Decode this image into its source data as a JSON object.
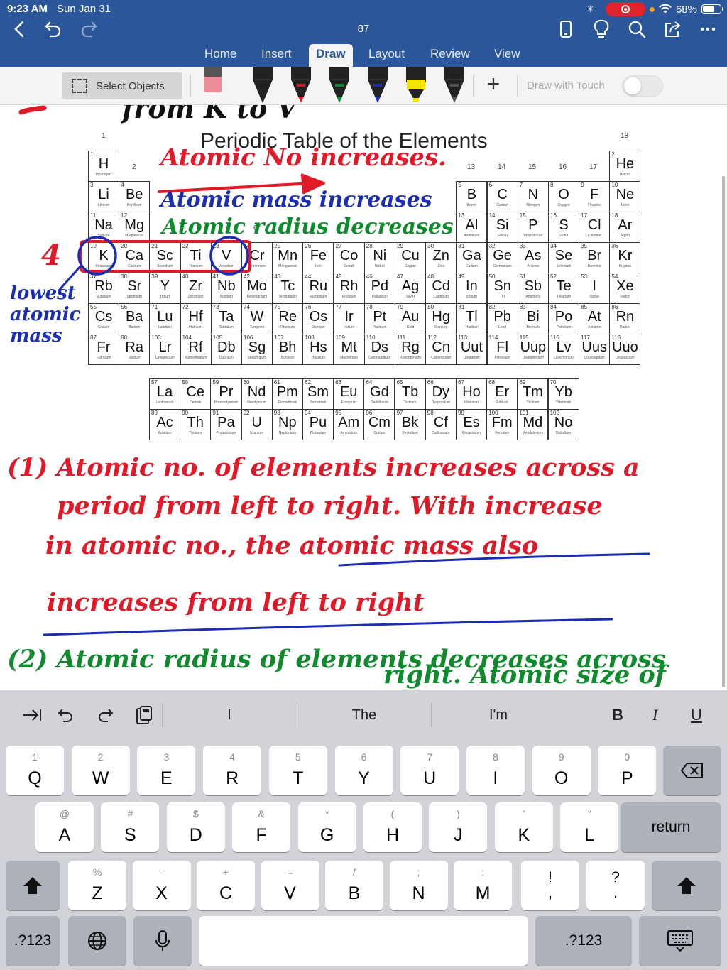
{
  "status_bar": {
    "time": "9:23 AM",
    "date": "Sun Jan 31",
    "battery": "68%"
  },
  "document": {
    "title": "87"
  },
  "tabs": [
    {
      "label": "Home",
      "active": false
    },
    {
      "label": "Insert",
      "active": false
    },
    {
      "label": "Draw",
      "active": true
    },
    {
      "label": "Layout",
      "active": false
    },
    {
      "label": "Review",
      "active": false
    },
    {
      "label": "View",
      "active": false
    }
  ],
  "ribbon": {
    "select_objects": "Select Objects",
    "draw_with_touch": "Draw with Touch",
    "draw_with_touch_on": false,
    "pen_colors": [
      "#ef8b96",
      "#1e1e1e",
      "#d41e2c",
      "#128a35",
      "#1c2db5",
      "#f5e400",
      "#555555"
    ]
  },
  "periodic_table": {
    "title": "Periodic Table of the Elements",
    "group_labels": [
      "1",
      "2",
      "13",
      "14",
      "15",
      "16",
      "17",
      "18",
      "6"
    ],
    "elements": [
      [
        "1",
        "H",
        "Hydrogen",
        1,
        1
      ],
      [
        "2",
        "He",
        "Helium",
        1,
        18
      ],
      [
        "3",
        "Li",
        "Lithium",
        2,
        1
      ],
      [
        "4",
        "Be",
        "Beryllium",
        2,
        2
      ],
      [
        "5",
        "B",
        "Boron",
        2,
        13
      ],
      [
        "6",
        "C",
        "Carbon",
        2,
        14
      ],
      [
        "7",
        "N",
        "Nitrogen",
        2,
        15
      ],
      [
        "8",
        "O",
        "Oxygen",
        2,
        16
      ],
      [
        "9",
        "F",
        "Fluorine",
        2,
        17
      ],
      [
        "10",
        "Ne",
        "Neon",
        2,
        18
      ],
      [
        "11",
        "Na",
        "Sodium",
        3,
        1
      ],
      [
        "12",
        "Mg",
        "Magnesium",
        3,
        2
      ],
      [
        "13",
        "Al",
        "Aluminum",
        3,
        13
      ],
      [
        "14",
        "Si",
        "Silicon",
        3,
        14
      ],
      [
        "15",
        "P",
        "Phosphorus",
        3,
        15
      ],
      [
        "16",
        "S",
        "Sulfur",
        3,
        16
      ],
      [
        "17",
        "Cl",
        "Chlorine",
        3,
        17
      ],
      [
        "18",
        "Ar",
        "Argon",
        3,
        18
      ],
      [
        "19",
        "K",
        "Potassium",
        4,
        1
      ],
      [
        "20",
        "Ca",
        "Calcium",
        4,
        2
      ],
      [
        "21",
        "Sc",
        "Scandium",
        4,
        3
      ],
      [
        "22",
        "Ti",
        "Titanium",
        4,
        4
      ],
      [
        "23",
        "V",
        "Vanadium",
        4,
        5
      ],
      [
        "24",
        "Cr",
        "Chromium",
        4,
        6
      ],
      [
        "25",
        "Mn",
        "Manganese",
        4,
        7
      ],
      [
        "26",
        "Fe",
        "Iron",
        4,
        8
      ],
      [
        "27",
        "Co",
        "Cobalt",
        4,
        9
      ],
      [
        "28",
        "Ni",
        "Nickel",
        4,
        10
      ],
      [
        "29",
        "Cu",
        "Copper",
        4,
        11
      ],
      [
        "30",
        "Zn",
        "Zinc",
        4,
        12
      ],
      [
        "31",
        "Ga",
        "Gallium",
        4,
        13
      ],
      [
        "32",
        "Ge",
        "Germanium",
        4,
        14
      ],
      [
        "33",
        "As",
        "Arsenic",
        4,
        15
      ],
      [
        "34",
        "Se",
        "Selenium",
        4,
        16
      ],
      [
        "35",
        "Br",
        "Bromine",
        4,
        17
      ],
      [
        "36",
        "Kr",
        "Krypton",
        4,
        18
      ],
      [
        "37",
        "Rb",
        "Rubidium",
        5,
        1
      ],
      [
        "38",
        "Sr",
        "Strontium",
        5,
        2
      ],
      [
        "39",
        "Y",
        "Yttrium",
        5,
        3
      ],
      [
        "40",
        "Zr",
        "Zirconium",
        5,
        4
      ],
      [
        "41",
        "Nb",
        "Niobium",
        5,
        5
      ],
      [
        "42",
        "Mo",
        "Molybdenum",
        5,
        6
      ],
      [
        "43",
        "Tc",
        "Technetium",
        5,
        7
      ],
      [
        "44",
        "Ru",
        "Ruthenium",
        5,
        8
      ],
      [
        "45",
        "Rh",
        "Rhodium",
        5,
        9
      ],
      [
        "46",
        "Pd",
        "Palladium",
        5,
        10
      ],
      [
        "47",
        "Ag",
        "Silver",
        5,
        11
      ],
      [
        "48",
        "Cd",
        "Cadmium",
        5,
        12
      ],
      [
        "49",
        "In",
        "Indium",
        5,
        13
      ],
      [
        "50",
        "Sn",
        "Tin",
        5,
        14
      ],
      [
        "51",
        "Sb",
        "Antimony",
        5,
        15
      ],
      [
        "52",
        "Te",
        "Tellurium",
        5,
        16
      ],
      [
        "53",
        "I",
        "Iodine",
        5,
        17
      ],
      [
        "54",
        "Xe",
        "Xenon",
        5,
        18
      ],
      [
        "55",
        "Cs",
        "Cesium",
        6,
        1
      ],
      [
        "56",
        "Ba",
        "Barium",
        6,
        2
      ],
      [
        "71",
        "Lu",
        "Lutetium",
        6,
        3
      ],
      [
        "72",
        "Hf",
        "Hafnium",
        6,
        4
      ],
      [
        "73",
        "Ta",
        "Tantalum",
        6,
        5
      ],
      [
        "74",
        "W",
        "Tungsten",
        6,
        6
      ],
      [
        "75",
        "Re",
        "Rhenium",
        6,
        7
      ],
      [
        "76",
        "Os",
        "Osmium",
        6,
        8
      ],
      [
        "77",
        "Ir",
        "Iridium",
        6,
        9
      ],
      [
        "78",
        "Pt",
        "Platinum",
        6,
        10
      ],
      [
        "79",
        "Au",
        "Gold",
        6,
        11
      ],
      [
        "80",
        "Hg",
        "Mercury",
        6,
        12
      ],
      [
        "81",
        "Tl",
        "Thallium",
        6,
        13
      ],
      [
        "82",
        "Pb",
        "Lead",
        6,
        14
      ],
      [
        "83",
        "Bi",
        "Bismuth",
        6,
        15
      ],
      [
        "84",
        "Po",
        "Polonium",
        6,
        16
      ],
      [
        "85",
        "At",
        "Astatine",
        6,
        17
      ],
      [
        "86",
        "Rn",
        "Radon",
        6,
        18
      ],
      [
        "87",
        "Fr",
        "Francium",
        7,
        1
      ],
      [
        "88",
        "Ra",
        "Radium",
        7,
        2
      ],
      [
        "103",
        "Lr",
        "Lawrencium",
        7,
        3
      ],
      [
        "104",
        "Rf",
        "Rutherfordium",
        7,
        4
      ],
      [
        "105",
        "Db",
        "Dubnium",
        7,
        5
      ],
      [
        "106",
        "Sg",
        "Seaborgium",
        7,
        6
      ],
      [
        "107",
        "Bh",
        "Bohrium",
        7,
        7
      ],
      [
        "108",
        "Hs",
        "Hassium",
        7,
        8
      ],
      [
        "109",
        "Mt",
        "Meitnerium",
        7,
        9
      ],
      [
        "110",
        "Ds",
        "Darmstadtium",
        7,
        10
      ],
      [
        "111",
        "Rg",
        "Roentgenium",
        7,
        11
      ],
      [
        "112",
        "Cn",
        "Copernicium",
        7,
        12
      ],
      [
        "113",
        "Uut",
        "Ununtrium",
        7,
        13
      ],
      [
        "114",
        "Fl",
        "Flerovium",
        7,
        14
      ],
      [
        "115",
        "Uup",
        "Ununpentium",
        7,
        15
      ],
      [
        "116",
        "Lv",
        "Livermorium",
        7,
        16
      ],
      [
        "117",
        "Uus",
        "Ununseptium",
        7,
        17
      ],
      [
        "118",
        "Uuo",
        "Ununoctium",
        7,
        18
      ],
      [
        "57",
        "La",
        "Lanthanum",
        9,
        1
      ],
      [
        "58",
        "Ce",
        "Cerium",
        9,
        2
      ],
      [
        "59",
        "Pr",
        "Praseodymium",
        9,
        3
      ],
      [
        "60",
        "Nd",
        "Neodymium",
        9,
        4
      ],
      [
        "61",
        "Pm",
        "Promethium",
        9,
        5
      ],
      [
        "62",
        "Sm",
        "Samarium",
        9,
        6
      ],
      [
        "63",
        "Eu",
        "Europium",
        9,
        7
      ],
      [
        "64",
        "Gd",
        "Gadolinium",
        9,
        8
      ],
      [
        "65",
        "Tb",
        "Terbium",
        9,
        9
      ],
      [
        "66",
        "Dy",
        "Dysprosium",
        9,
        10
      ],
      [
        "67",
        "Ho",
        "Holmium",
        9,
        11
      ],
      [
        "68",
        "Er",
        "Erbium",
        9,
        12
      ],
      [
        "69",
        "Tm",
        "Thulium",
        9,
        13
      ],
      [
        "70",
        "Yb",
        "Ytterbium",
        9,
        14
      ],
      [
        "89",
        "Ac",
        "Actinium",
        10,
        1
      ],
      [
        "90",
        "Th",
        "Thorium",
        10,
        2
      ],
      [
        "91",
        "Pa",
        "Protactinium",
        10,
        3
      ],
      [
        "92",
        "U",
        "Uranium",
        10,
        4
      ],
      [
        "93",
        "Np",
        "Neptunium",
        10,
        5
      ],
      [
        "94",
        "Pu",
        "Plutonium",
        10,
        6
      ],
      [
        "95",
        "Am",
        "Americium",
        10,
        7
      ],
      [
        "96",
        "Cm",
        "Curium",
        10,
        8
      ],
      [
        "97",
        "Bk",
        "Berkelium",
        10,
        9
      ],
      [
        "98",
        "Cf",
        "Californium",
        10,
        10
      ],
      [
        "99",
        "Es",
        "Einsteinium",
        10,
        11
      ],
      [
        "100",
        "Fm",
        "Fermium",
        10,
        12
      ],
      [
        "101",
        "Md",
        "Mendelevium",
        10,
        13
      ],
      [
        "102",
        "No",
        "Nobelium",
        10,
        14
      ]
    ]
  },
  "annotations": {
    "top_partial": "from K to V",
    "atomic_no": "Atomic No increases.",
    "atomic_mass": "Atomic mass increases",
    "atomic_radius": "Atomic radius decreases",
    "period_number": "4",
    "lowest_label": "lowest atomic mass",
    "note1_line1": "(1) Atomic no. of elements increases across a",
    "note1_line2": "period from left to right. With increase",
    "note1_line3": "in atomic no., the atomic mass also",
    "note1_line4": "increases from left to right",
    "note2_line1": "(2) Atomic radius of elements decreases across",
    "note2_line2": "right. Atomic size of"
  },
  "keyboard": {
    "suggestions": [
      "I",
      "The",
      "I'm"
    ],
    "format": [
      "B",
      "I",
      "U"
    ],
    "row1": [
      [
        "Q",
        "1"
      ],
      [
        "W",
        "2"
      ],
      [
        "E",
        "3"
      ],
      [
        "R",
        "4"
      ],
      [
        "T",
        "5"
      ],
      [
        "Y",
        "6"
      ],
      [
        "U",
        "7"
      ],
      [
        "I",
        "8"
      ],
      [
        "O",
        "9"
      ],
      [
        "P",
        "0"
      ]
    ],
    "row2": [
      [
        "A",
        "@"
      ],
      [
        "S",
        "#"
      ],
      [
        "D",
        "$"
      ],
      [
        "F",
        "&"
      ],
      [
        "G",
        "*"
      ],
      [
        "H",
        "("
      ],
      [
        "J",
        ")"
      ],
      [
        "K",
        "'"
      ],
      [
        "L",
        "\""
      ]
    ],
    "row3": [
      [
        "Z",
        "%"
      ],
      [
        "X",
        "-"
      ],
      [
        "C",
        "+"
      ],
      [
        "V",
        "="
      ],
      [
        "B",
        "/"
      ],
      [
        "N",
        ";"
      ],
      [
        "M",
        ":"
      ]
    ],
    "punct1_main": "!",
    "punct1_sub": ",",
    "punct2_main": "?",
    "punct2_sub": ".",
    "return_label": "return",
    "numbers_label": ".?123"
  }
}
